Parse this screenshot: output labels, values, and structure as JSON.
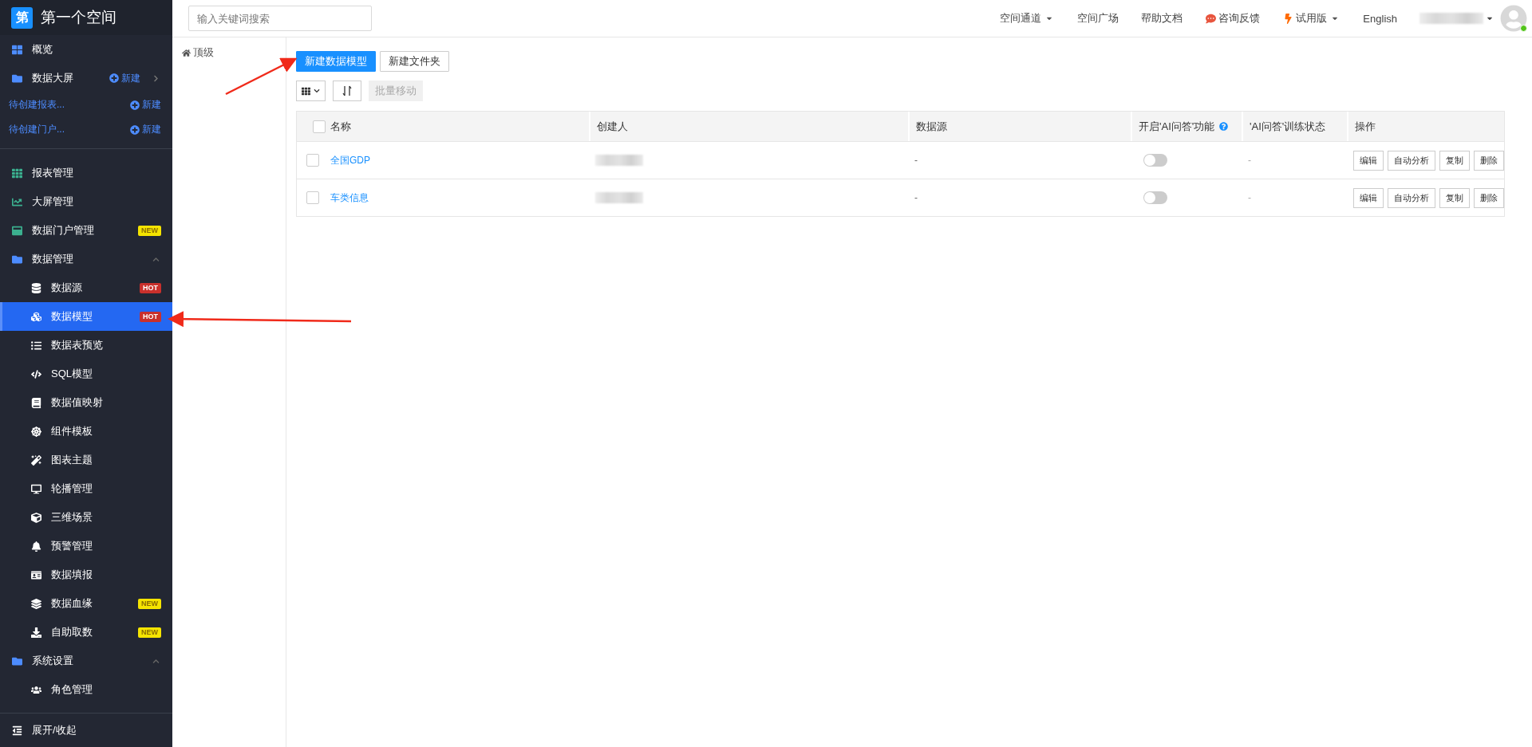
{
  "sidebar": {
    "logo": "第",
    "title": "第一个空间",
    "quick": [
      {
        "label": "概览",
        "kind": "item"
      },
      {
        "label": "数据大屏",
        "kind": "folder",
        "action": "新建"
      }
    ],
    "pending": [
      {
        "label": "待创建报表...",
        "action": "新建"
      },
      {
        "label": "待创建门户...",
        "action": "新建"
      }
    ],
    "items": [
      {
        "label": "报表管理",
        "selected": false
      },
      {
        "label": "大屏管理",
        "selected": false
      },
      {
        "label": "数据门户管理",
        "selected": false,
        "badge": "NEW",
        "color": "#f5e400"
      },
      {
        "label": "数据管理",
        "selected": false,
        "expanded": true,
        "children": [
          {
            "label": "数据源",
            "selected": false,
            "badge": "HOT",
            "color": "#c9302c"
          },
          {
            "label": "数据模型",
            "selected": true,
            "badge": "HOT",
            "color": "#c9302c"
          },
          {
            "label": "数据表预览",
            "selected": false
          },
          {
            "label": "SQL模型",
            "selected": false
          },
          {
            "label": "数据值映射",
            "selected": false
          },
          {
            "label": "组件模板",
            "selected": false
          },
          {
            "label": "图表主题",
            "selected": false
          },
          {
            "label": "轮播管理",
            "selected": false
          },
          {
            "label": "三维场景",
            "selected": false
          },
          {
            "label": "预警管理",
            "selected": false
          },
          {
            "label": "数据填报",
            "selected": false
          },
          {
            "label": "数据血缘",
            "selected": false,
            "badge": "NEW",
            "color": "#f5e400"
          },
          {
            "label": "自助取数",
            "selected": false,
            "badge": "NEW",
            "color": "#f5e400"
          }
        ]
      },
      {
        "label": "系统设置",
        "selected": false,
        "expanded": true,
        "children": [
          {
            "label": "角色管理",
            "selected": false
          }
        ]
      }
    ],
    "footer": "展开/收起"
  },
  "topbar": {
    "search": {
      "placeholder": "输入关键词搜索"
    },
    "nav": [
      {
        "label": "空间通道",
        "kind": "dropdown"
      },
      {
        "label": "空间广场",
        "kind": "link"
      },
      {
        "label": "帮助文档",
        "kind": "link"
      },
      {
        "label": "咨询反馈",
        "kind": "chat"
      },
      {
        "label": "试用版",
        "kind": "trial"
      },
      {
        "label": "English",
        "kind": "link"
      }
    ],
    "user": {
      "online": true
    }
  },
  "folders": {
    "root": "顶级"
  },
  "toolbar": {
    "buttons": [
      {
        "label": "新建数据模型",
        "kind": "primary"
      },
      {
        "label": "新建文件夹",
        "kind": "default"
      }
    ],
    "batch": {
      "label": "批量移动",
      "disabled": true
    }
  },
  "table": {
    "all_checked": false,
    "columns": [
      "名称",
      "创建人",
      "数据源",
      "开启'AI问答'功能",
      "'AI问答'训练状态",
      "操作"
    ],
    "rows": [
      {
        "checked": false,
        "name": "全国GDP",
        "datasource": "-",
        "ai_on": false,
        "status": "-",
        "actions": [
          "编辑",
          "自动分析",
          "复制",
          "删除"
        ]
      },
      {
        "checked": false,
        "name": "车类信息",
        "datasource": "-",
        "ai_on": false,
        "status": "-",
        "actions": [
          "编辑",
          "自动分析",
          "复制",
          "删除"
        ]
      }
    ]
  }
}
